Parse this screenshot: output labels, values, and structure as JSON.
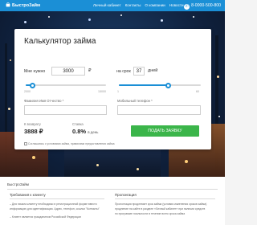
{
  "header": {
    "logo_icon": "brand-logo-icon",
    "logo_text": "БыстроЗайм",
    "nav": [
      "Личный кабинет",
      "Контакты",
      "О компании",
      "Новости"
    ],
    "phone_icon": "phone-icon",
    "phone_glyph": "✆",
    "phone": "8-0000-500-800"
  },
  "calculator": {
    "title": "Калькулятор займа",
    "amount_label": "Мне нужно",
    "amount_value": "3000",
    "currency": "₽",
    "amount_min": "2000",
    "amount_max": "15000",
    "amount_fraction": 0.08,
    "term_label": "на срок",
    "term_value": "37",
    "term_unit": "дней",
    "term_min": "1",
    "term_max": "60",
    "term_fraction": 0.6,
    "name_label": "Фамилия Имя Отчество *",
    "name_value": "",
    "phone_label": "Мобильный телефон *",
    "phone_value": "",
    "repay_label": "К возврату",
    "repay_value": "3888",
    "repay_currency": "₽",
    "rate_label": "Ставка",
    "rate_value": "0.8%",
    "rate_unit": "в день",
    "submit_label": "ПОДАТЬ ЗАЯВКУ",
    "consent": "Соглашаюсь с условиями займа, правилами предоставления займа"
  },
  "info": {
    "title": "БыстроЗайм",
    "left_heading": "Требования к клиенту",
    "left_lines": [
      "– Для начала клиенту необходимо в регистрационной форме ввести",
      "информацию для идентификации. Адрес, телефон, ссылки \"Контакты\"",
      "– Клиент является гражданином Российской Федерации"
    ],
    "right_heading": "Пролонгация",
    "right_lines": [
      "Пролонгация продлевает срок займа (условия изменения сроков займа)",
      "продление на сайте в разделе «Личный кабинет» при наличии средств",
      "по программе лояльности в течение всего срока займа"
    ]
  },
  "colors": {
    "brand_blue": "#1b8fd6",
    "submit_green": "#3bb54a",
    "hero_bg": "#10223f"
  }
}
